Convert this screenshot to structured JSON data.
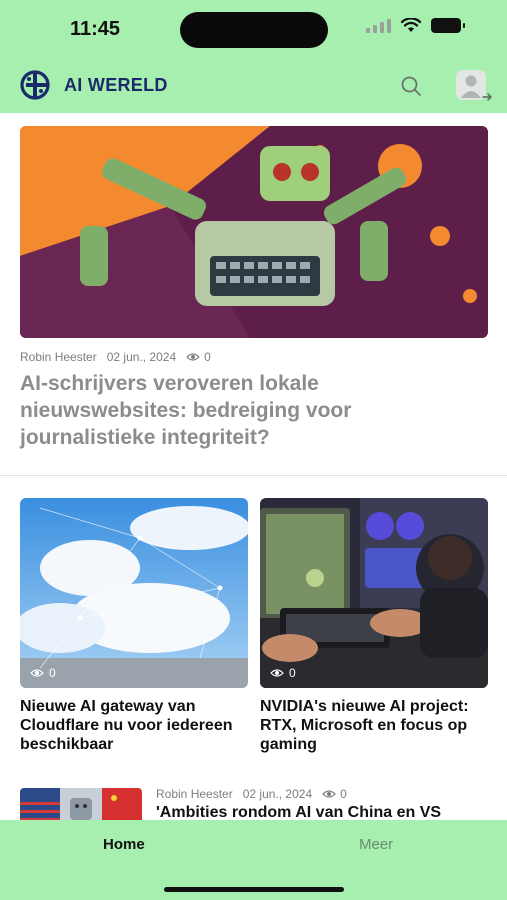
{
  "status_bar": {
    "time": "11:45"
  },
  "app": {
    "brand": "AI WERELD"
  },
  "featured": {
    "author": "Robin Heester",
    "date": "02 jun., 2024",
    "views": "0",
    "title": "AI-schrijvers veroveren lokale nieuwswebsites: bedreiging voor journalistieke integriteit?"
  },
  "cards": [
    {
      "views": "0",
      "title": "Nieuwe AI gateway van Cloudflare nu voor iedereen beschikbaar"
    },
    {
      "views": "0",
      "title": "NVIDIA's nieuwe AI project: RTX, Microsoft en focus op gaming"
    }
  ],
  "list": [
    {
      "author": "Robin Heester",
      "date": "02 jun., 2024",
      "views": "0",
      "title": "'Ambities rondom AI van China en VS"
    }
  ],
  "tabbar": {
    "home": "Home",
    "more": "Meer"
  },
  "colors": {
    "header_bg": "#a6efae",
    "brand": "#1b2a6b"
  }
}
